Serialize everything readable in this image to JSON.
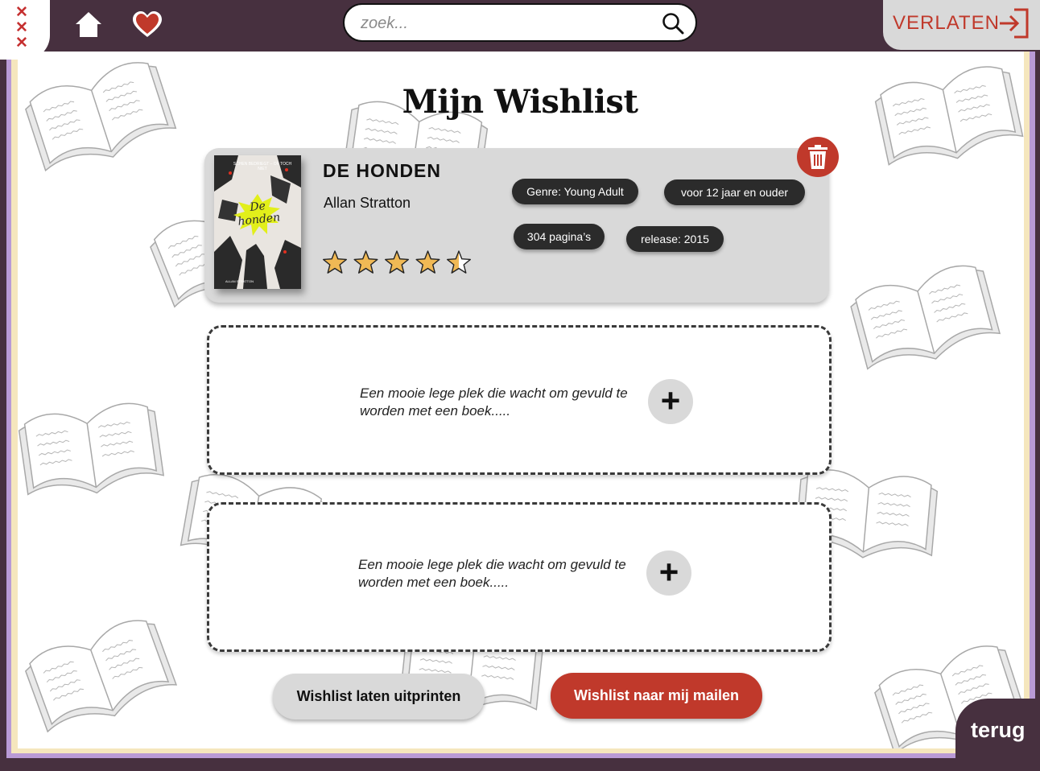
{
  "header": {
    "search_placeholder": "zoek...",
    "exit_label": "VERLATEN"
  },
  "page": {
    "title": "Mijn Wishlist"
  },
  "wishlist": {
    "book": {
      "title": "DE HONDEN",
      "author": "Allan Stratton",
      "rating": 4.5,
      "rating_max": 5,
      "cover": {
        "top_text": "SCHEN BEDRIEGT – OF TOCH NIET",
        "title": "De honden",
        "author": "ALLAN STRATTON"
      },
      "tags": {
        "genre": "Genre: Young Adult",
        "age": "voor 12 jaar en ouder",
        "pages": "304 pagina’s",
        "release": "release: 2015"
      }
    },
    "empty_slots": [
      {
        "text": "Een mooie lege plek die wacht om gevuld te worden met een boek.....",
        "add_label": "+"
      },
      {
        "text": "Een mooie lege plek die wacht om gevuld te worden met een boek.....",
        "add_label": "+"
      }
    ]
  },
  "actions": {
    "print_label": "Wishlist laten uitprinten",
    "mail_label": "Wishlist naar mij mailen",
    "back_label": "terug"
  },
  "colors": {
    "header_bg": "#47303f",
    "accent_red": "#c0392b",
    "card_gray": "#d9d9d9",
    "tag_dark": "#2b2b2b",
    "star_fill": "#f0b955",
    "frame_purple": "#b99ad6",
    "frame_cream": "#f5e6bd"
  },
  "icons": {
    "logo": "amsterdam-xxx-icon",
    "home": "home-icon",
    "favorites": "heart-icon",
    "search": "search-icon",
    "exit": "exit-icon",
    "delete": "trash-icon",
    "add": "plus-icon",
    "background": "open-book-icon"
  }
}
